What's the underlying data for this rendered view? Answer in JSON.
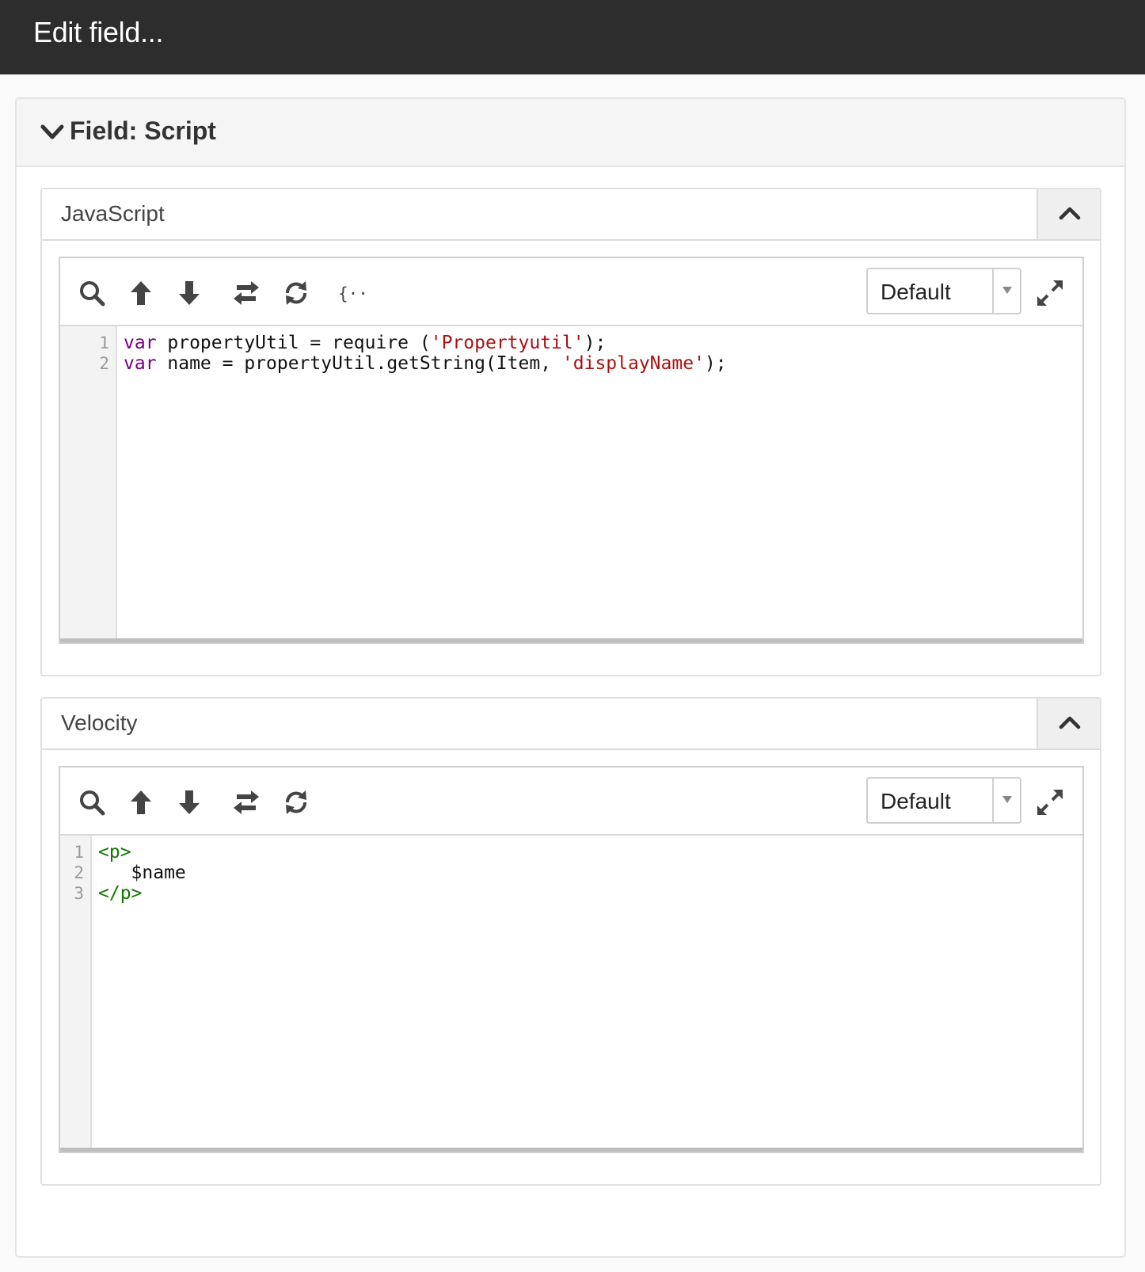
{
  "header": {
    "title": "Edit field..."
  },
  "section": {
    "label": "Field: Script"
  },
  "panels": [
    {
      "title": "JavaScript",
      "mode_select": "Default",
      "line_numbers": [
        "1",
        "2"
      ],
      "code": [
        [
          {
            "t": "var",
            "c": "kw"
          },
          {
            "t": " propertyUtil = require ("
          },
          {
            "t": "'Propertyutil'",
            "c": "str"
          },
          {
            "t": ");"
          }
        ],
        [
          {
            "t": "var",
            "c": "kw"
          },
          {
            "t": " name = propertyUtil.getString(Item, "
          },
          {
            "t": "'displayName'",
            "c": "str"
          },
          {
            "t": ");"
          }
        ]
      ],
      "toolbar_icons": [
        "search-icon",
        "arrow-up-icon",
        "arrow-down-icon",
        "swap-icon",
        "refresh-icon",
        "braces-icon"
      ]
    },
    {
      "title": "Velocity",
      "mode_select": "Default",
      "line_numbers": [
        "1",
        "2",
        "3"
      ],
      "code": [
        [
          {
            "t": "<p>",
            "c": "tag"
          }
        ],
        [
          {
            "t": "   $name"
          }
        ],
        [
          {
            "t": "</p>",
            "c": "tag"
          }
        ]
      ],
      "toolbar_icons": [
        "search-icon",
        "arrow-up-icon",
        "arrow-down-icon",
        "swap-icon",
        "refresh-icon"
      ]
    }
  ]
}
